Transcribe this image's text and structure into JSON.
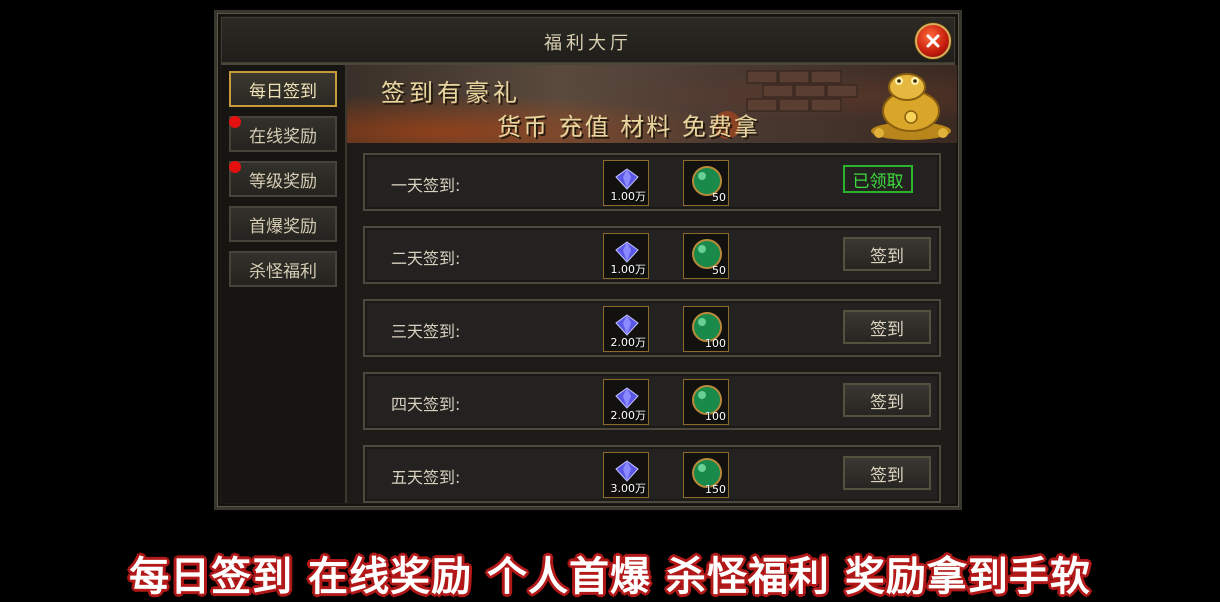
{
  "window": {
    "title": "福利大厅"
  },
  "sidebar": {
    "items": [
      {
        "label": "每日签到",
        "active": true,
        "badge": false
      },
      {
        "label": "在线奖励",
        "active": false,
        "badge": true
      },
      {
        "label": "等级奖励",
        "active": false,
        "badge": true
      },
      {
        "label": "首爆奖励",
        "active": false,
        "badge": false
      },
      {
        "label": "杀怪福利",
        "active": false,
        "badge": false
      }
    ]
  },
  "banner": {
    "line1": "签到有豪礼",
    "line2": "货币 充值 材料 免费拿"
  },
  "rows": [
    {
      "label": "一天签到:",
      "reward1": "1.00万",
      "reward2": "50",
      "status": "claimed",
      "action": "已领取"
    },
    {
      "label": "二天签到:",
      "reward1": "1.00万",
      "reward2": "50",
      "status": "available",
      "action": "签到"
    },
    {
      "label": "三天签到:",
      "reward1": "2.00万",
      "reward2": "100",
      "status": "available",
      "action": "签到"
    },
    {
      "label": "四天签到:",
      "reward1": "2.00万",
      "reward2": "100",
      "status": "available",
      "action": "签到"
    },
    {
      "label": "五天签到:",
      "reward1": "3.00万",
      "reward2": "150",
      "status": "available",
      "action": "签到"
    }
  ],
  "caption": "每日签到 在线奖励 个人首爆 杀怪福利 奖励拿到手软",
  "colors": {
    "accent_gold": "#c89a3c",
    "claimed_green": "#2bb32b",
    "badge_red": "#e51010"
  },
  "icons": {
    "close": "close-x-icon",
    "gem": "blue-gem-icon",
    "orb": "green-orb-icon"
  }
}
